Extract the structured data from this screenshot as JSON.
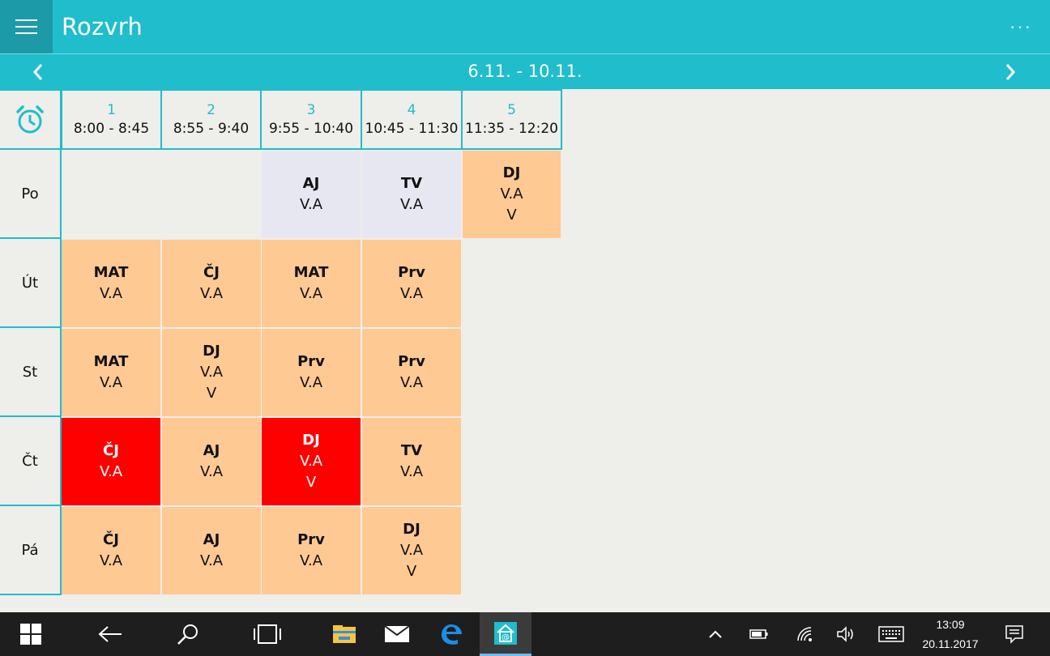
{
  "app": {
    "title": "Rozvrh",
    "more_label": "···"
  },
  "week": {
    "label": "6.11. - 10.11."
  },
  "periods": [
    {
      "num": "1",
      "time": "8:00 - 8:45"
    },
    {
      "num": "2",
      "time": "8:55 - 9:40"
    },
    {
      "num": "3",
      "time": "9:55 - 10:40"
    },
    {
      "num": "4",
      "time": "10:45 - 11:30"
    },
    {
      "num": "5",
      "time": "11:35 - 12:20"
    }
  ],
  "days": [
    "Po",
    "Út",
    "St",
    "Čt",
    "Pá"
  ],
  "lessons": {
    "po_3": {
      "subject": "AJ",
      "room": "V.A"
    },
    "po_4": {
      "subject": "TV",
      "room": "V.A"
    },
    "po_5": {
      "subject": "DJ",
      "room": "V.A",
      "group": "V"
    },
    "ut_1": {
      "subject": "MAT",
      "room": "V.A"
    },
    "ut_2": {
      "subject": "ČJ",
      "room": "V.A"
    },
    "ut_3": {
      "subject": "MAT",
      "room": "V.A"
    },
    "ut_4": {
      "subject": "Prv",
      "room": "V.A"
    },
    "st_1": {
      "subject": "MAT",
      "room": "V.A"
    },
    "st_2": {
      "subject": "DJ",
      "room": "V.A",
      "group": "V"
    },
    "st_3": {
      "subject": "Prv",
      "room": "V.A"
    },
    "st_4": {
      "subject": "Prv",
      "room": "V.A"
    },
    "ct_1": {
      "subject": "ČJ",
      "room": "V.A"
    },
    "ct_2": {
      "subject": "AJ",
      "room": "V.A"
    },
    "ct_3": {
      "subject": "DJ",
      "room": "V.A",
      "group": "V"
    },
    "ct_4": {
      "subject": "TV",
      "room": "V.A"
    },
    "pa_1": {
      "subject": "ČJ",
      "room": "V.A"
    },
    "pa_2": {
      "subject": "AJ",
      "room": "V.A"
    },
    "pa_3": {
      "subject": "Prv",
      "room": "V.A"
    },
    "pa_4": {
      "subject": "DJ",
      "room": "V.A",
      "group": "V"
    }
  },
  "colors": {
    "accent": "#20bdcc",
    "lesson_normal": "#ffc994",
    "lesson_changed": "#e6e7f1",
    "lesson_cancelled": "#ff0000"
  },
  "taskbar": {
    "time": "13:09",
    "date": "20.11.2017",
    "icons": [
      "windows-start-icon",
      "back-icon",
      "search-icon",
      "task-view-icon",
      "file-explorer-icon",
      "mail-icon",
      "edge-icon",
      "app-icon",
      "chevron-up-icon",
      "battery-icon",
      "wifi-icon",
      "volume-icon",
      "keyboard-icon",
      "notification-icon"
    ]
  }
}
